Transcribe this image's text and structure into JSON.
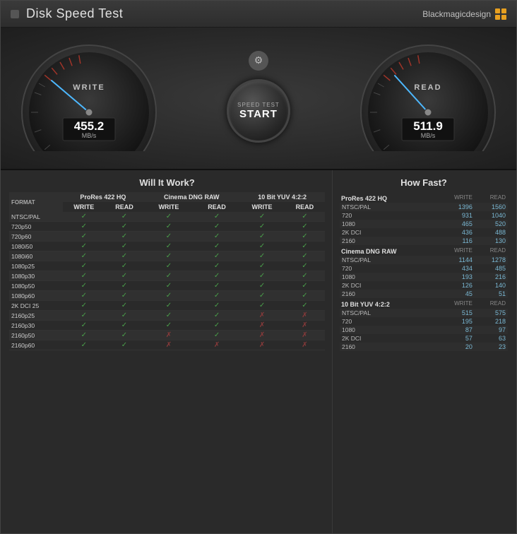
{
  "window": {
    "title": "Disk Speed Test",
    "brand": "Blackmagicdesign"
  },
  "brand_dots": [
    {
      "color": "#e8a020"
    },
    {
      "color": "#e8a020"
    },
    {
      "color": "#e8a020"
    },
    {
      "color": "#e8a020"
    }
  ],
  "gauges": {
    "write": {
      "label": "WRITE",
      "value": "455.2",
      "unit": "MB/s"
    },
    "read": {
      "label": "READ",
      "value": "511.9",
      "unit": "MB/s"
    }
  },
  "start_button": {
    "top_text": "SPEED TEST",
    "main_text": "START"
  },
  "will_it_work": {
    "title": "Will It Work?",
    "col_groups": [
      "ProRes 422 HQ",
      "Cinema DNG RAW",
      "10 Bit YUV 4:2:2"
    ],
    "sub_cols": [
      "WRITE",
      "READ"
    ],
    "format_col": "FORMAT",
    "rows": [
      {
        "format": "NTSC/PAL",
        "pres_w": true,
        "pres_r": true,
        "dng_w": true,
        "dng_r": true,
        "yuv_w": true,
        "yuv_r": true
      },
      {
        "format": "720p50",
        "pres_w": true,
        "pres_r": true,
        "dng_w": true,
        "dng_r": true,
        "yuv_w": true,
        "yuv_r": true
      },
      {
        "format": "720p60",
        "pres_w": true,
        "pres_r": true,
        "dng_w": true,
        "dng_r": true,
        "yuv_w": true,
        "yuv_r": true
      },
      {
        "format": "1080i50",
        "pres_w": true,
        "pres_r": true,
        "dng_w": true,
        "dng_r": true,
        "yuv_w": true,
        "yuv_r": true
      },
      {
        "format": "1080i60",
        "pres_w": true,
        "pres_r": true,
        "dng_w": true,
        "dng_r": true,
        "yuv_w": true,
        "yuv_r": true
      },
      {
        "format": "1080p25",
        "pres_w": true,
        "pres_r": true,
        "dng_w": true,
        "dng_r": true,
        "yuv_w": true,
        "yuv_r": true
      },
      {
        "format": "1080p30",
        "pres_w": true,
        "pres_r": true,
        "dng_w": true,
        "dng_r": true,
        "yuv_w": true,
        "yuv_r": true
      },
      {
        "format": "1080p50",
        "pres_w": true,
        "pres_r": true,
        "dng_w": true,
        "dng_r": true,
        "yuv_w": true,
        "yuv_r": true
      },
      {
        "format": "1080p60",
        "pres_w": true,
        "pres_r": true,
        "dng_w": true,
        "dng_r": true,
        "yuv_w": true,
        "yuv_r": true
      },
      {
        "format": "2K DCI 25",
        "pres_w": true,
        "pres_r": true,
        "dng_w": true,
        "dng_r": true,
        "yuv_w": true,
        "yuv_r": true
      },
      {
        "format": "2160p25",
        "pres_w": true,
        "pres_r": true,
        "dng_w": true,
        "dng_r": true,
        "yuv_w": false,
        "yuv_r": false
      },
      {
        "format": "2160p30",
        "pres_w": true,
        "pres_r": true,
        "dng_w": true,
        "dng_r": true,
        "yuv_w": false,
        "yuv_r": false
      },
      {
        "format": "2160p50",
        "pres_w": true,
        "pres_r": true,
        "dng_w": false,
        "dng_r": true,
        "yuv_w": false,
        "yuv_r": false
      },
      {
        "format": "2160p60",
        "pres_w": true,
        "pres_r": true,
        "dng_w": false,
        "dng_r": false,
        "yuv_w": false,
        "yuv_r": false
      }
    ]
  },
  "how_fast": {
    "title": "How Fast?",
    "sections": [
      {
        "name": "ProRes 422 HQ",
        "rows": [
          {
            "label": "NTSC/PAL",
            "write": "1396",
            "read": "1560"
          },
          {
            "label": "720",
            "write": "931",
            "read": "1040"
          },
          {
            "label": "1080",
            "write": "465",
            "read": "520"
          },
          {
            "label": "2K DCI",
            "write": "436",
            "read": "488"
          },
          {
            "label": "2160",
            "write": "116",
            "read": "130"
          }
        ]
      },
      {
        "name": "Cinema DNG RAW",
        "rows": [
          {
            "label": "NTSC/PAL",
            "write": "1144",
            "read": "1278"
          },
          {
            "label": "720",
            "write": "434",
            "read": "485"
          },
          {
            "label": "1080",
            "write": "193",
            "read": "216"
          },
          {
            "label": "2K DCI",
            "write": "126",
            "read": "140"
          },
          {
            "label": "2160",
            "write": "45",
            "read": "51"
          }
        ]
      },
      {
        "name": "10 Bit YUV 4:2:2",
        "rows": [
          {
            "label": "NTSC/PAL",
            "write": "515",
            "read": "575"
          },
          {
            "label": "720",
            "write": "195",
            "read": "218"
          },
          {
            "label": "1080",
            "write": "87",
            "read": "97"
          },
          {
            "label": "2K DCI",
            "write": "57",
            "read": "63"
          },
          {
            "label": "2160",
            "write": "20",
            "read": "23"
          }
        ]
      }
    ]
  }
}
